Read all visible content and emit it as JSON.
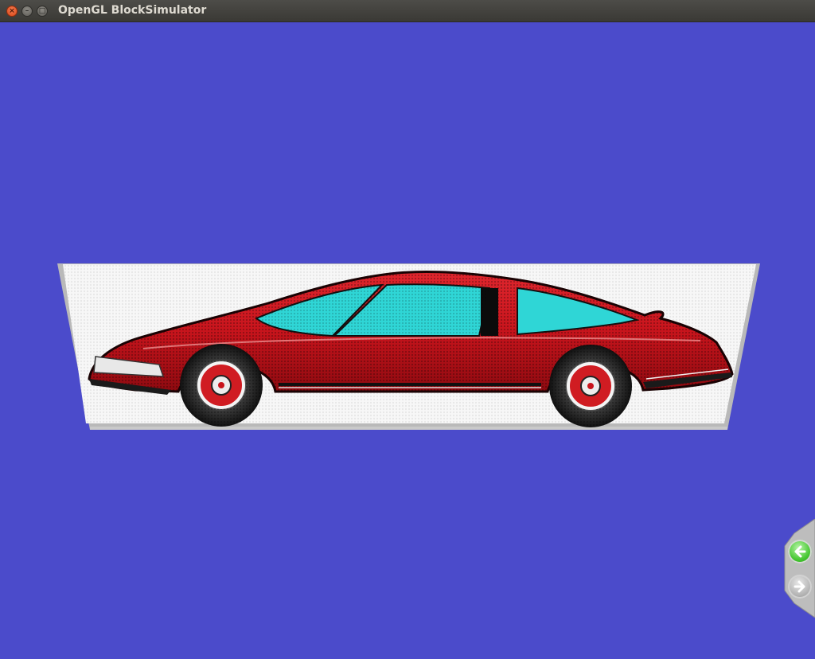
{
  "window": {
    "title": "OpenGL BlockSimulator",
    "controls": {
      "close_glyph": "×",
      "minimize_glyph": "–",
      "maximize_glyph": "□"
    }
  },
  "viewport": {
    "background_color": "#4b4bcb",
    "image_board": {
      "subject": "red sports car rendered in blocks",
      "colors": {
        "body": "#c8141c",
        "glass": "#2fd6d6",
        "background": "#f7f7f7",
        "frame": "#b9b9b9"
      }
    }
  },
  "nav": {
    "back_icon": "arrow-left-icon",
    "forward_icon": "arrow-right-icon",
    "back_color": "#42c52e",
    "forward_color": "#b4b4b4"
  }
}
